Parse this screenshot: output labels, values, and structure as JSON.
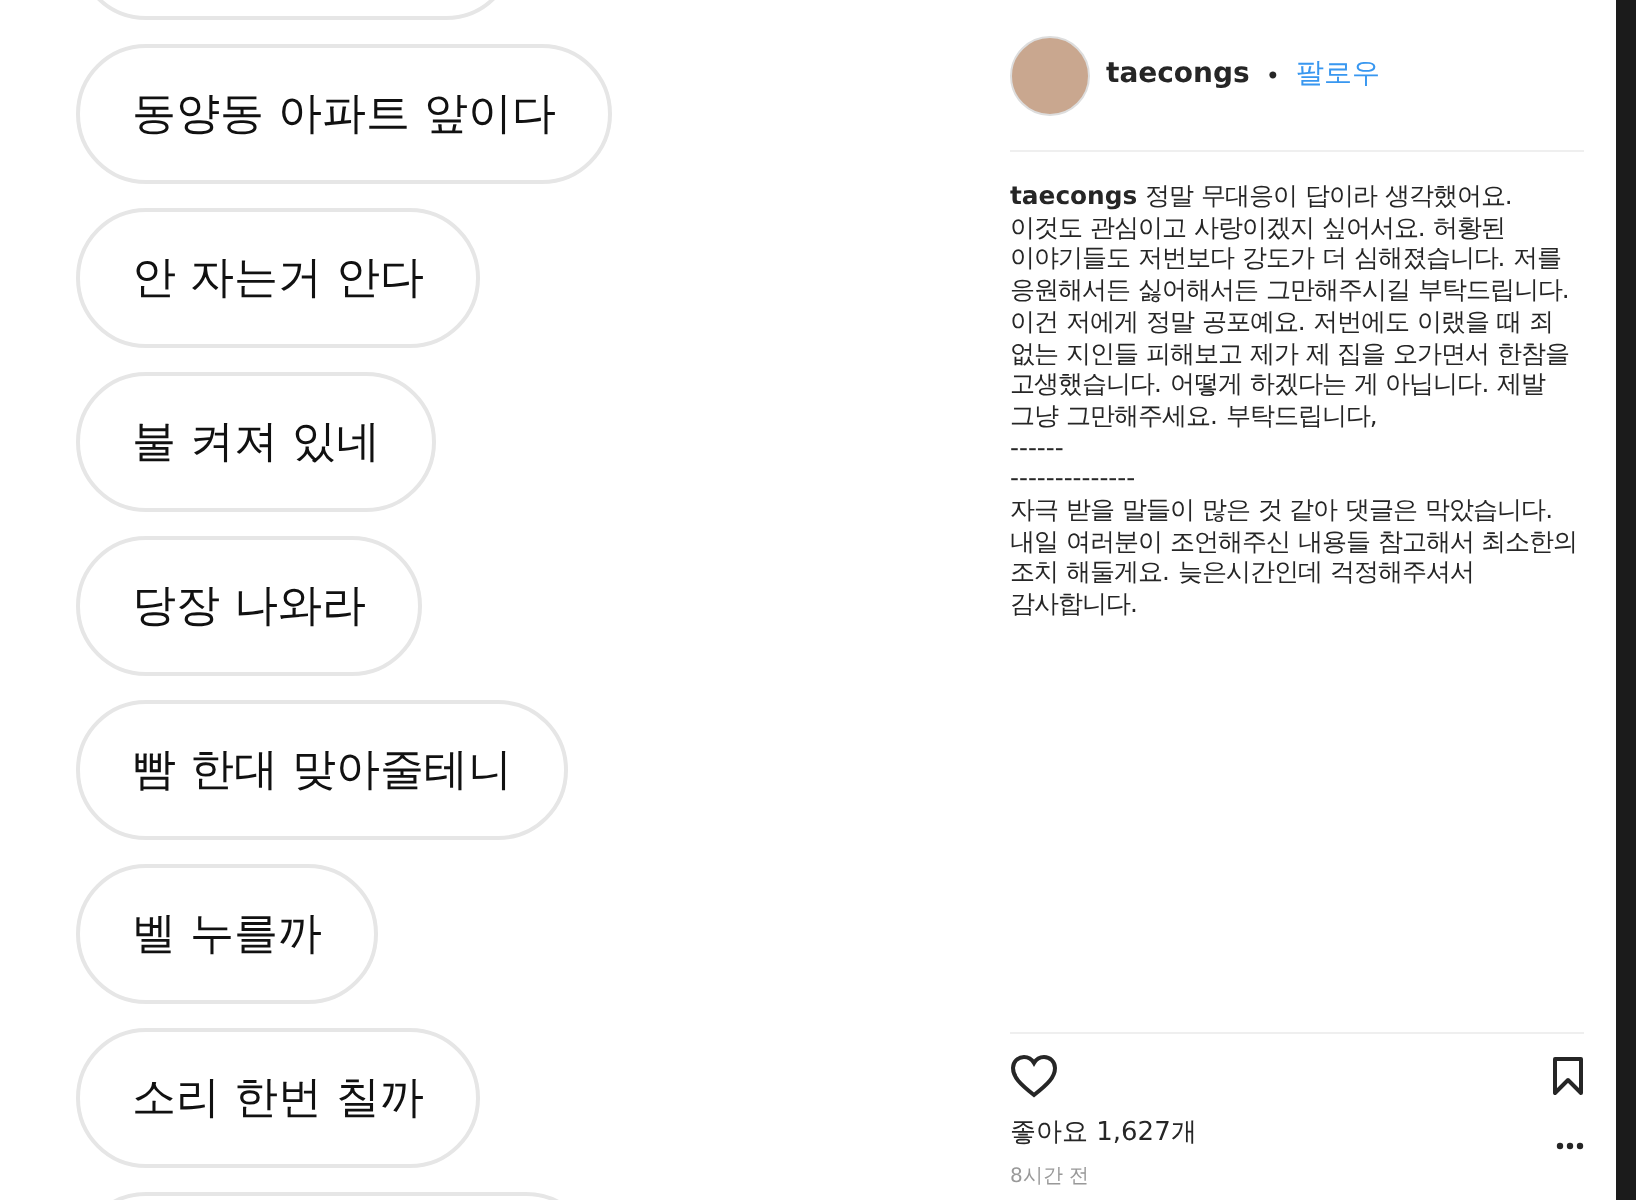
{
  "chat_bubbles": [
    {
      "text": "동양동 아파트 앞이다"
    },
    {
      "text": "안 자는거 안다"
    },
    {
      "text": "불 켜져 있네"
    },
    {
      "text": "당장 나와라"
    },
    {
      "text": "빰 한대 맞아줄테니"
    },
    {
      "text": "벨 누를까"
    },
    {
      "text": "소리 한번 칠까"
    }
  ],
  "post": {
    "username": "taecongs",
    "separator": "•",
    "follow": "팔로우",
    "caption_username": "taecongs",
    "caption": "정말 무대응이 답이라 생각했어요. 이것도 관심이고 사랑이겠지 싶어서요. 허황된 이야기들도 저번보다 강도가 더 심해졌습니다. 저를 응원해서든 싫어해서든 그만해주시길 부탁드립니다. 이건 저에게 정말 공포예요. 저번에도 이랬을 때 죄 없는 지인들 피해보고 제가 제 집을 오가면서 한참을 고생했습니다. 어떻게 하겠다는 게 아닙니다. 제발 그냥 그만해주세요. 부탁드립니다,\n------\n--------------\n자극 받을 말들이 많은 것 같아 댓글은 막았습니다. 내일 여러분이 조언해주신 내용들 참고해서 최소한의 조치 해둘게요. 늦은시간인데 걱정해주셔서 감사합니다.",
    "likes": "좋아요 1,627개",
    "time": "8시간 전"
  }
}
